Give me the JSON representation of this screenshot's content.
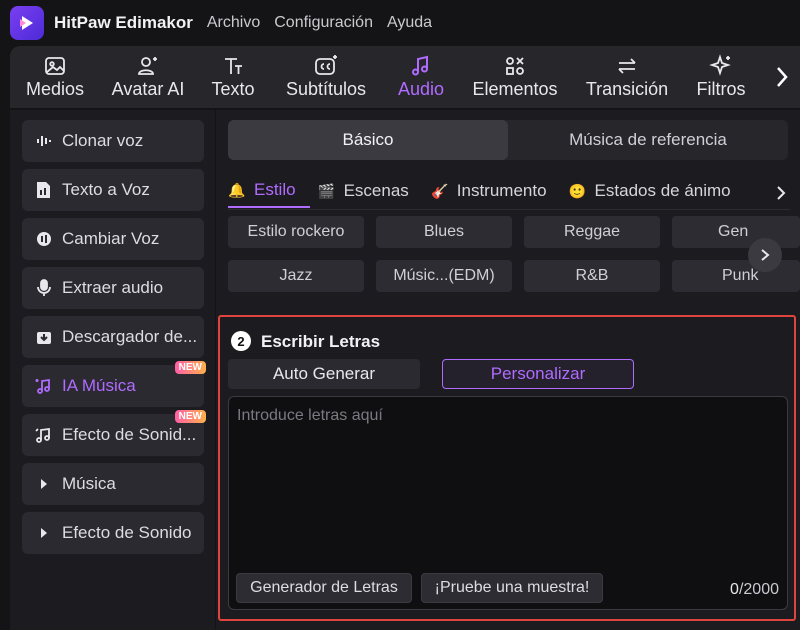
{
  "app": {
    "name": "HitPaw Edimakor",
    "menu": [
      "Archivo",
      "Configuración",
      "Ayuda"
    ]
  },
  "toolbar": {
    "items": [
      {
        "label": "Medios",
        "icon": "image-icon"
      },
      {
        "label": "Avatar AI",
        "icon": "avatar-icon"
      },
      {
        "label": "Texto",
        "icon": "text-icon"
      },
      {
        "label": "Subtítulos",
        "icon": "captions-icon"
      },
      {
        "label": "Audio",
        "icon": "music-note-icon",
        "active": true
      },
      {
        "label": "Elementos",
        "icon": "elements-icon"
      },
      {
        "label": "Transición",
        "icon": "transition-icon"
      },
      {
        "label": "Filtros",
        "icon": "sparkle-icon"
      }
    ],
    "accent_color": "#b06bff"
  },
  "sidebar": {
    "items": [
      {
        "label": "Clonar voz",
        "icon": "waveform-icon"
      },
      {
        "label": "Texto a Voz",
        "icon": "document-voice-icon"
      },
      {
        "label": "Cambiar Voz",
        "icon": "voice-change-icon"
      },
      {
        "label": "Extraer audio",
        "icon": "microphone-icon"
      },
      {
        "label": "Descargador de...",
        "icon": "download-icon"
      },
      {
        "label": "IA Música",
        "icon": "ai-music-icon",
        "active": true,
        "badge": "NEW"
      },
      {
        "label": "Efecto de Sonid...",
        "icon": "sound-effect-icon",
        "badge": "NEW"
      },
      {
        "label": "Música",
        "icon": "caret-right-icon"
      },
      {
        "label": "Efecto de Sonido",
        "icon": "caret-right-icon"
      }
    ]
  },
  "segment": {
    "options": [
      "Básico",
      "Música de referencia"
    ],
    "selected": "Básico"
  },
  "tabs": [
    {
      "label": "Estilo",
      "icon": "🔔",
      "active": true
    },
    {
      "label": "Escenas",
      "icon": "🎬"
    },
    {
      "label": "Instrumento",
      "icon": "🎸"
    },
    {
      "label": "Estados de ánimo",
      "icon": "🙂"
    }
  ],
  "styles": [
    "Estilo rockero",
    "Blues",
    "Reggae",
    "Gen",
    "Jazz",
    "Músic...(EDM)",
    "R&B",
    "Punk"
  ],
  "lyrics": {
    "step": "2",
    "title": "Escribir Letras",
    "mode_auto": "Auto Generar",
    "mode_custom": "Personalizar",
    "placeholder": "Introduce letras aquí",
    "generator_button": "Generador de Letras",
    "sample_button": "¡Pruebe una muestra!",
    "count_current": "0",
    "count_max": "/2000",
    "highlight_color": "#e0453d"
  }
}
